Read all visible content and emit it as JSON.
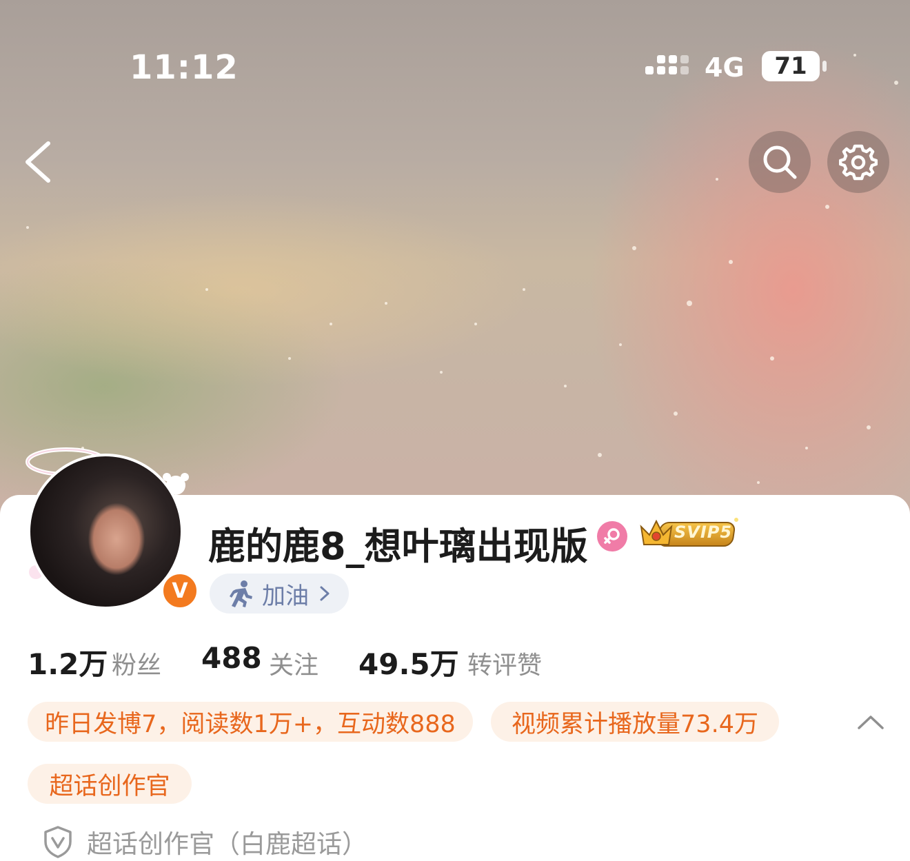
{
  "status_bar": {
    "time": "11:12",
    "network": "4G",
    "battery": "71"
  },
  "header": {
    "back_icon": "chevron-left-icon",
    "search_icon": "search-icon",
    "settings_icon": "gear-icon"
  },
  "profile": {
    "username": "鹿的鹿8_想叶璃出现版",
    "verified_mark": "V",
    "gender_icon": "female-icon",
    "vip_label": "SVIP5",
    "cheer_label": "加油",
    "colors": {
      "accent_orange": "#e8671d",
      "tag_bg": "#fdf1e7",
      "verified_orange": "#f37a1f",
      "female_pink": "#f07ca7",
      "chip_blue": "#6d7ea8"
    }
  },
  "stats": [
    {
      "value": "1.2万",
      "label": "粉丝"
    },
    {
      "value": "488",
      "label": "关注"
    },
    {
      "value": "49.5万",
      "label": "转评赞"
    }
  ],
  "tags": [
    "昨日发博7，阅读数1万+，互动数888",
    "视频累计播放量73.4万",
    "超话创作官"
  ],
  "footer": {
    "icon": "shield-v-icon",
    "text": "超话创作官（白鹿超话）"
  }
}
